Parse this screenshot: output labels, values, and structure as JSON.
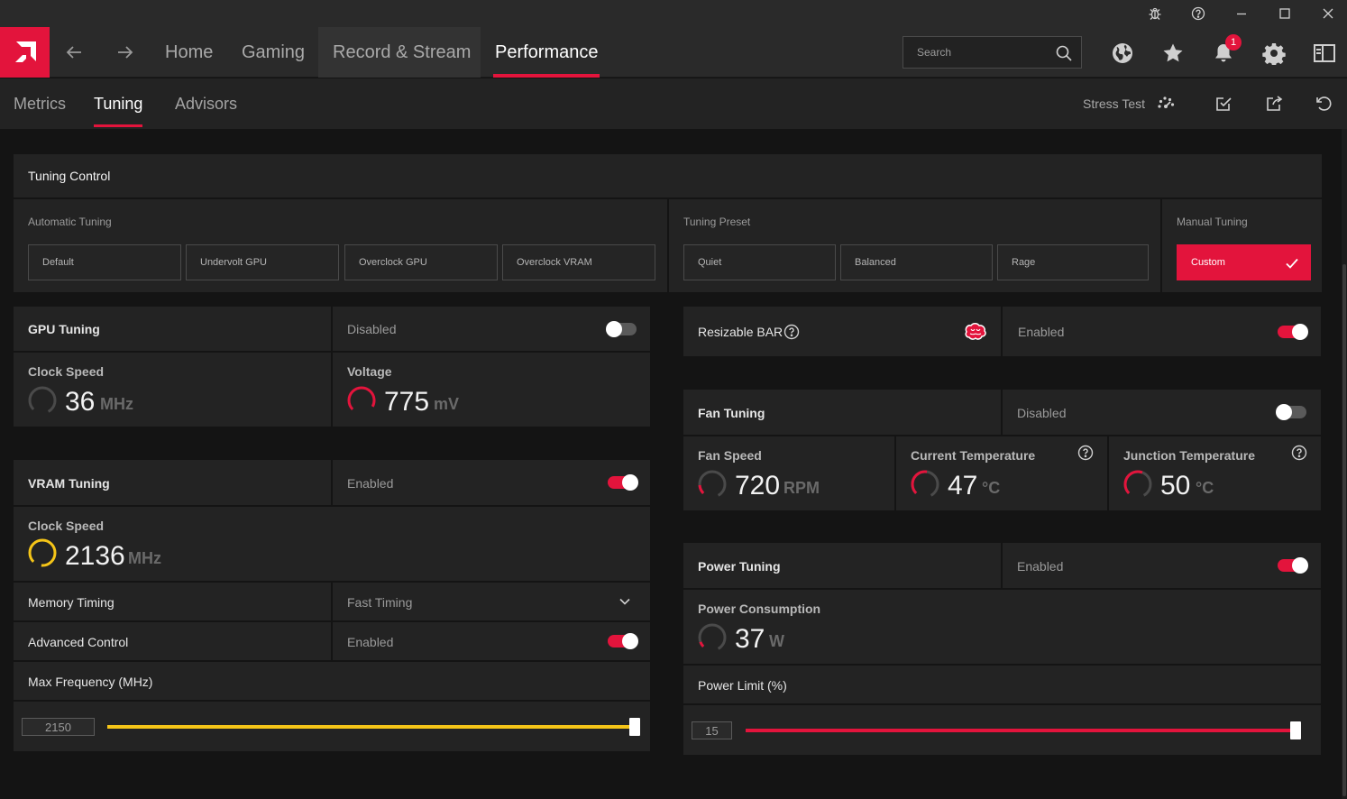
{
  "titlebar": {
    "icons": [
      "bug-icon",
      "help-icon",
      "minimize-icon",
      "maximize-icon",
      "close-icon"
    ]
  },
  "nav": {
    "tabs": [
      {
        "label": "Home"
      },
      {
        "label": "Gaming"
      },
      {
        "label": "Record & Stream"
      },
      {
        "label": "Performance"
      }
    ],
    "active_tab": "Performance",
    "search_placeholder": "Search",
    "notification_count": "1"
  },
  "subnav": {
    "tabs": [
      {
        "label": "Metrics"
      },
      {
        "label": "Tuning"
      },
      {
        "label": "Advisors"
      }
    ],
    "active_tab": "Tuning",
    "stress_test_label": "Stress Test"
  },
  "colors": {
    "accent": "#e3143c",
    "vram_gauge": "#f5c518",
    "panel_bg": "#232323",
    "app_bg": "#141414"
  },
  "tuning_control": {
    "title": "Tuning Control",
    "automatic": {
      "label": "Automatic Tuning",
      "options": [
        "Default",
        "Undervolt GPU",
        "Overclock GPU",
        "Overclock VRAM"
      ]
    },
    "preset": {
      "label": "Tuning Preset",
      "options": [
        "Quiet",
        "Balanced",
        "Rage"
      ]
    },
    "manual": {
      "label": "Manual Tuning",
      "option": "Custom",
      "selected": true
    }
  },
  "gpu_tuning": {
    "title": "GPU Tuning",
    "state": "Disabled",
    "enabled": false,
    "clock_label": "Clock Speed",
    "clock_value": "36",
    "clock_unit": "MHz",
    "voltage_label": "Voltage",
    "voltage_value": "775",
    "voltage_unit": "mV"
  },
  "vram_tuning": {
    "title": "VRAM Tuning",
    "state": "Enabled",
    "enabled": true,
    "clock_label": "Clock Speed",
    "clock_value": "2136",
    "clock_unit": "MHz",
    "memory_timing_label": "Memory Timing",
    "memory_timing_value": "Fast Timing",
    "advanced_label": "Advanced Control",
    "advanced_value": "Enabled",
    "advanced_enabled": true,
    "max_freq_label": "Max Frequency (MHz)",
    "max_freq_value": "2150",
    "max_freq_fill": 1.0
  },
  "resizable_bar": {
    "title": "Resizable BAR",
    "state": "Enabled",
    "enabled": true
  },
  "fan_tuning": {
    "title": "Fan Tuning",
    "state": "Disabled",
    "enabled": false,
    "fan_speed_label": "Fan Speed",
    "fan_speed_value": "720",
    "fan_speed_unit": "RPM",
    "current_temp_label": "Current Temperature",
    "current_temp_value": "47",
    "current_temp_unit": "°C",
    "junction_temp_label": "Junction Temperature",
    "junction_temp_value": "50",
    "junction_temp_unit": "°C"
  },
  "power_tuning": {
    "title": "Power Tuning",
    "state": "Enabled",
    "enabled": true,
    "consumption_label": "Power Consumption",
    "consumption_value": "37",
    "consumption_unit": "W",
    "limit_label": "Power Limit (%)",
    "limit_value": "15",
    "limit_fill": 1.0
  }
}
